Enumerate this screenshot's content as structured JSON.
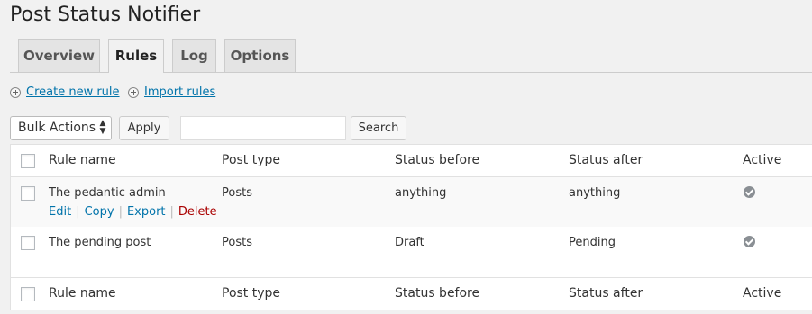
{
  "page": {
    "title": "Post Status Notifier"
  },
  "tabs": [
    {
      "label": "Overview"
    },
    {
      "label": "Rules"
    },
    {
      "label": "Log"
    },
    {
      "label": "Options"
    }
  ],
  "links": {
    "create_new_rule": "Create new rule",
    "import_rules": "Import rules"
  },
  "toolbar": {
    "bulk_actions": "Bulk Actions",
    "apply": "Apply",
    "search_value": "",
    "search_button": "Search"
  },
  "table": {
    "columns": [
      "Rule name",
      "Post type",
      "Status before",
      "Status after",
      "Active"
    ],
    "rows": [
      {
        "rule_name": "The pedantic admin",
        "post_type": "Posts",
        "status_before": "anything",
        "status_after": "anything",
        "active": true,
        "row_actions": [
          "Edit",
          "Copy",
          "Export",
          "Delete"
        ]
      },
      {
        "rule_name": "The pending post",
        "post_type": "Posts",
        "status_before": "Draft",
        "status_after": "Pending",
        "active": true
      }
    ]
  },
  "colors": {
    "link": "#0073aa",
    "delete": "#aa0000"
  }
}
